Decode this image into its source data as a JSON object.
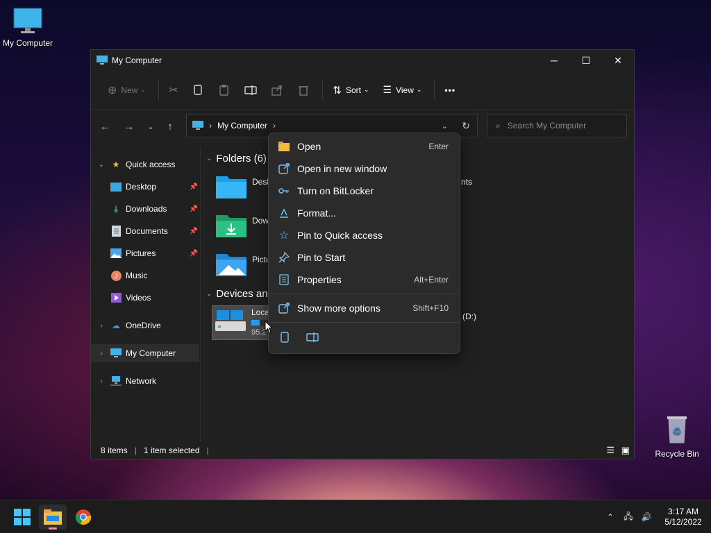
{
  "desktop": {
    "icons": [
      {
        "label": "My Computer"
      },
      {
        "label": "Recycle Bin"
      }
    ]
  },
  "window": {
    "title": "My Computer",
    "controls": {
      "minimize": "─",
      "maximize": "☐",
      "close": "✕"
    }
  },
  "toolbar": {
    "new_label": "New",
    "sort_label": "Sort",
    "view_label": "View",
    "more_label": "•••"
  },
  "address": {
    "path": "My Computer",
    "search_placeholder": "Search My Computer"
  },
  "sidebar": {
    "items": [
      {
        "label": "Quick access"
      },
      {
        "label": "Desktop"
      },
      {
        "label": "Downloads"
      },
      {
        "label": "Documents"
      },
      {
        "label": "Pictures"
      },
      {
        "label": "Music"
      },
      {
        "label": "Videos"
      },
      {
        "label": "OneDrive"
      },
      {
        "label": "My Computer"
      },
      {
        "label": "Network"
      }
    ]
  },
  "content": {
    "folders_header": "Folders (6)",
    "devices_header": "Devices and",
    "folders": [
      {
        "label": "Desk"
      },
      {
        "label": "Dow"
      },
      {
        "label": "Pictu"
      }
    ],
    "partial_right_label": "nts",
    "drive": {
      "label": "Loca",
      "size_text": "95.2",
      "usage": 0.3
    },
    "drive_d_label": "(D:)"
  },
  "context_menu": {
    "items": [
      {
        "label": "Open",
        "accel": "Enter"
      },
      {
        "label": "Open in new window",
        "accel": ""
      },
      {
        "label": "Turn on BitLocker",
        "accel": ""
      },
      {
        "label": "Format...",
        "accel": ""
      },
      {
        "label": "Pin to Quick access",
        "accel": ""
      },
      {
        "label": "Pin to Start",
        "accel": ""
      },
      {
        "label": "Properties",
        "accel": "Alt+Enter"
      },
      {
        "label": "Show more options",
        "accel": "Shift+F10"
      }
    ]
  },
  "status": {
    "items_count": "8 items",
    "selected": "1 item selected"
  },
  "taskbar": {
    "time": "3:17 AM",
    "date": "5/12/2022"
  },
  "colors": {
    "accent": "#60cdff",
    "folder_blue": "#1e90e0",
    "folder_green": "#2db37a"
  }
}
